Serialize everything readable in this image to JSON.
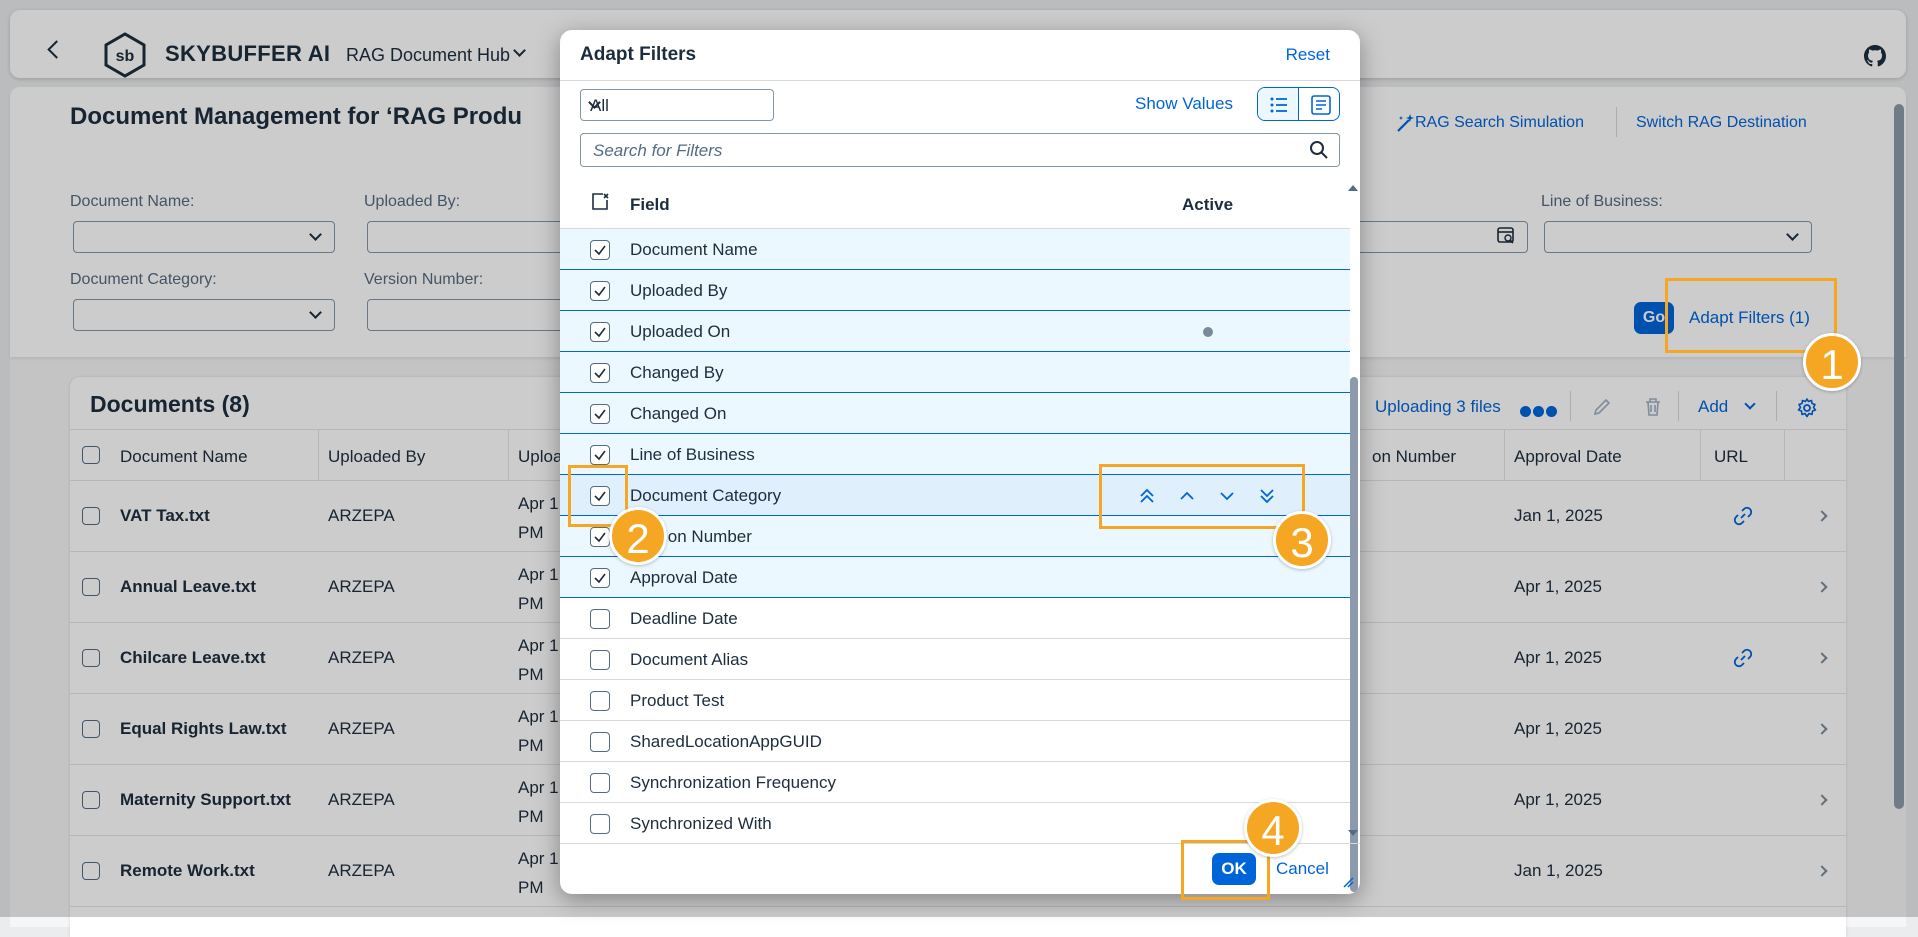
{
  "shell": {
    "brand": "SKYBUFFER AI",
    "app_title": "RAG Document Hub"
  },
  "page": {
    "title": "Document Management for ‘RAG Produ",
    "rag_search_simulation": "RAG Search Simulation",
    "switch_rag_destination": "Switch RAG Destination",
    "filters": {
      "document_name": "Document Name:",
      "uploaded_by": "Uploaded By:",
      "line_of_business": "Line of Business:",
      "document_category": "Document Category:",
      "version_number": "Version Number:"
    },
    "go_label": "Go",
    "adapt_filters_label": "Adapt Filters (1)"
  },
  "documents": {
    "title": "Documents (8)",
    "uploading": "Uploading 3 files",
    "add_label": "Add",
    "columns": [
      "Document Name",
      "Uploaded By",
      "Uploa",
      "on Number",
      "Approval Date",
      "URL"
    ],
    "rows": [
      {
        "name": "VAT Tax.txt",
        "uploaded_by": "ARZEPA",
        "upload_date": "Apr 1",
        "upload_time": "PM",
        "approval_date": "Jan 1, 2025",
        "has_url": true
      },
      {
        "name": "Annual Leave.txt",
        "uploaded_by": "ARZEPA",
        "upload_date": "Apr 1",
        "upload_time": "PM",
        "approval_date": "Apr 1, 2025",
        "has_url": false
      },
      {
        "name": "Chilcare Leave.txt",
        "uploaded_by": "ARZEPA",
        "upload_date": "Apr 1",
        "upload_time": "PM",
        "approval_date": "Apr 1, 2025",
        "has_url": true
      },
      {
        "name": "Equal Rights Law.txt",
        "uploaded_by": "ARZEPA",
        "upload_date": "Apr 1",
        "upload_time": "PM",
        "approval_date": "Apr 1, 2025",
        "has_url": false
      },
      {
        "name": "Maternity Support.txt",
        "uploaded_by": "ARZEPA",
        "upload_date": "Apr 1",
        "upload_time": "PM",
        "approval_date": "Apr 1, 2025",
        "has_url": false
      },
      {
        "name": "Remote Work.txt",
        "uploaded_by": "ARZEPA",
        "upload_date": "Apr 1",
        "upload_time": "PM",
        "approval_date": "Jan 1, 2025",
        "has_url": false
      }
    ]
  },
  "dialog": {
    "title": "Adapt Filters",
    "reset": "Reset",
    "view_select": "All",
    "show_values": "Show Values",
    "search_placeholder": "Search for Filters",
    "col_field": "Field",
    "col_active": "Active",
    "fields": [
      {
        "label": "Document Name",
        "checked": true,
        "active": false
      },
      {
        "label": "Uploaded By",
        "checked": true,
        "active": false
      },
      {
        "label": "Uploaded On",
        "checked": true,
        "active": true
      },
      {
        "label": "Changed By",
        "checked": true,
        "active": false
      },
      {
        "label": "Changed On",
        "checked": true,
        "active": false
      },
      {
        "label": "Line of Business",
        "checked": true,
        "active": false
      },
      {
        "label": "Document Category",
        "checked": true,
        "active": false,
        "focused": true
      },
      {
        "label": "Version Number",
        "checked": true,
        "active": false
      },
      {
        "label": "Approval Date",
        "checked": true,
        "active": false
      },
      {
        "label": "Deadline Date",
        "checked": false,
        "active": false
      },
      {
        "label": "Document Alias",
        "checked": false,
        "active": false
      },
      {
        "label": "Product Test",
        "checked": false,
        "active": false
      },
      {
        "label": "SharedLocationAppGUID",
        "checked": false,
        "active": false
      },
      {
        "label": "Synchronization Frequency",
        "checked": false,
        "active": false
      },
      {
        "label": "Synchronized With",
        "checked": false,
        "active": false
      }
    ],
    "ok_label": "OK",
    "cancel_label": "Cancel"
  },
  "annotations": [
    "1",
    "2",
    "3",
    "4"
  ],
  "colors": {
    "accent": "#0064d9",
    "highlight": "#f5a623",
    "selected_row": "#ebf8ff"
  }
}
